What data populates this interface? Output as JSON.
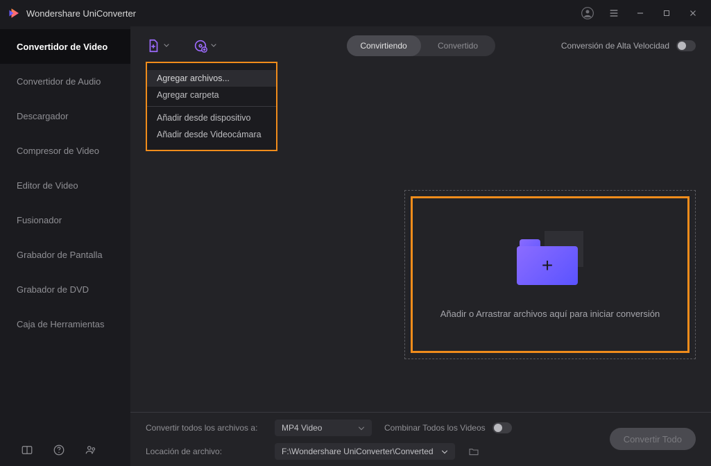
{
  "titlebar": {
    "title": "Wondershare UniConverter"
  },
  "sidebar": {
    "items": [
      {
        "label": "Convertidor de Video",
        "active": true
      },
      {
        "label": "Convertidor de Audio"
      },
      {
        "label": "Descargador"
      },
      {
        "label": "Compresor de Video"
      },
      {
        "label": "Editor de Video"
      },
      {
        "label": "Fusionador"
      },
      {
        "label": "Grabador de Pantalla"
      },
      {
        "label": "Grabador de DVD"
      },
      {
        "label": "Caja de Herramientas"
      }
    ]
  },
  "toolbar": {
    "tabs": {
      "active": "Convirtiendo",
      "inactive": "Convertido"
    },
    "high_speed_label": "Conversión de Alta Velocidad"
  },
  "dropdown": {
    "group1": [
      "Agregar archivos...",
      "Agregar carpeta"
    ],
    "group2": [
      "Añadir desde dispositivo",
      "Añadir desde Videocámara"
    ]
  },
  "dropzone": {
    "text": "Añadir o Arrastrar archivos aquí para iniciar conversión"
  },
  "bottombar": {
    "convert_all_label": "Convertir todos los archivos a:",
    "format": "MP4 Video",
    "combine_label": "Combinar Todos los Videos",
    "location_label": "Locación de archivo:",
    "path": "F:\\Wondershare UniConverter\\Converted",
    "convert_button": "Convertir Todo"
  }
}
